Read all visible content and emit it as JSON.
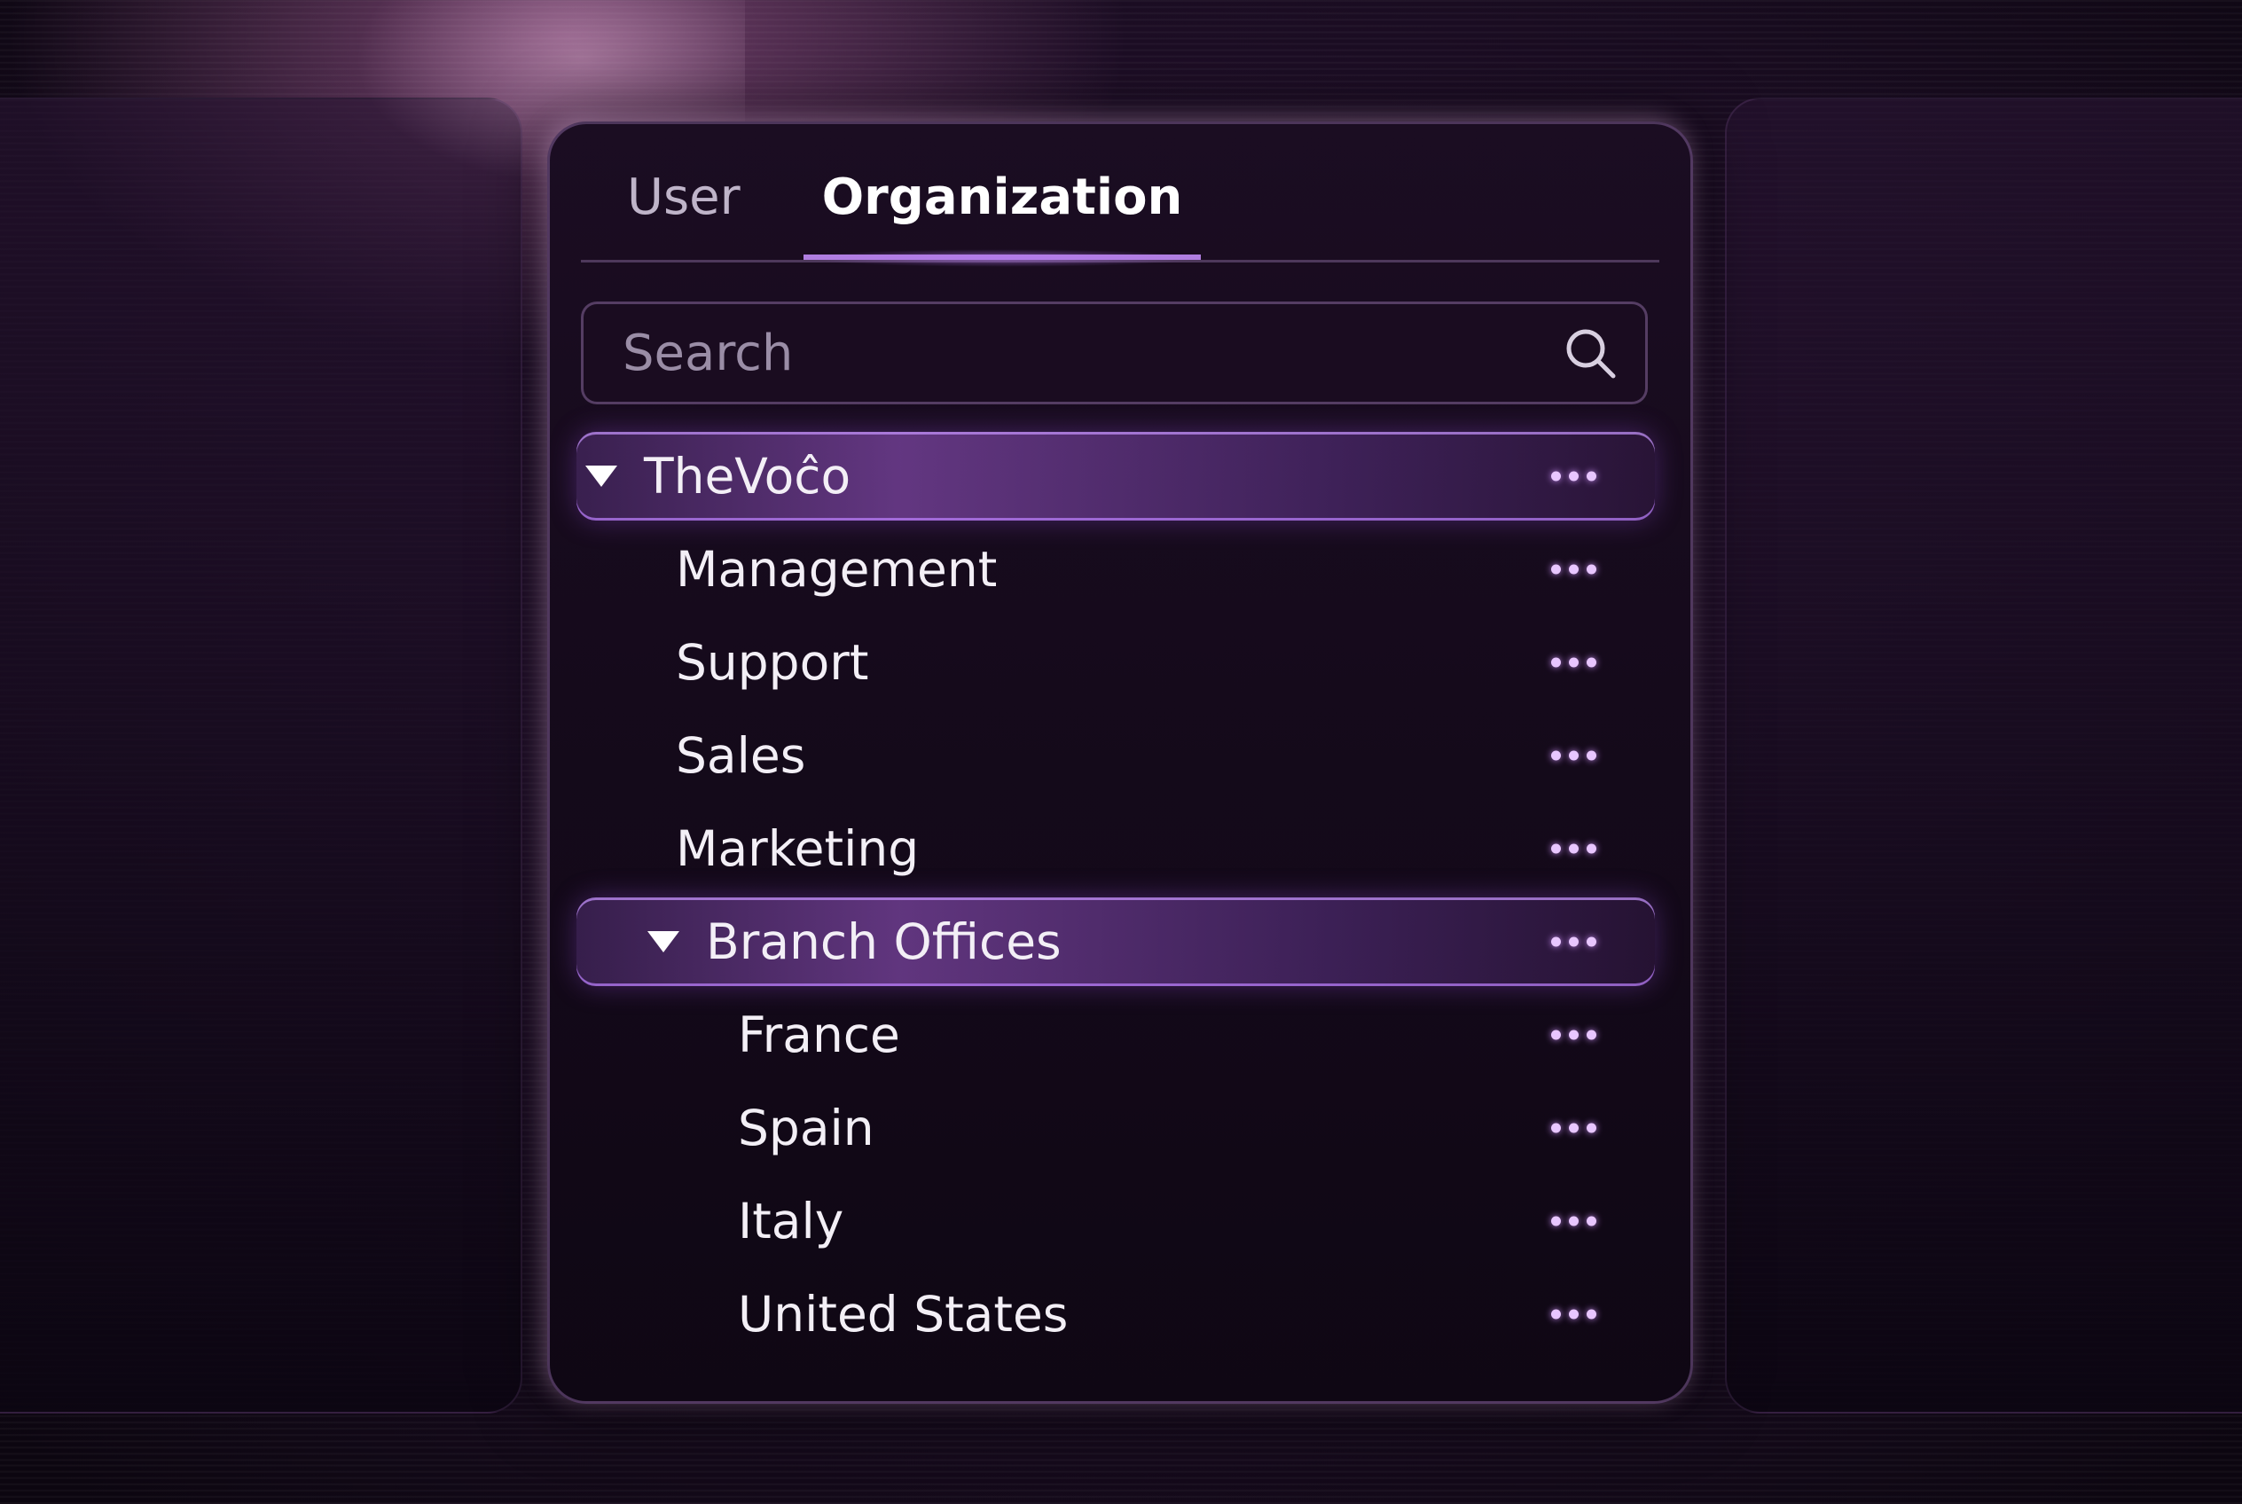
{
  "tabs": {
    "user": "User",
    "organization": "Organization",
    "active": "organization"
  },
  "search": {
    "placeholder": "Search",
    "value": ""
  },
  "tree": {
    "items": [
      {
        "label": "TheVoĉo",
        "level": 0,
        "expanded": true,
        "selected": true
      },
      {
        "label": "Management",
        "level": 1
      },
      {
        "label": "Support",
        "level": 1
      },
      {
        "label": "Sales",
        "level": 1
      },
      {
        "label": "Marketing",
        "level": 1
      },
      {
        "label": "Branch Offices",
        "level": 1,
        "expanded": true,
        "selected": true
      },
      {
        "label": "France",
        "level": 2
      },
      {
        "label": "Spain",
        "level": 2
      },
      {
        "label": "Italy",
        "level": 2
      },
      {
        "label": "United States",
        "level": 2
      }
    ],
    "more_icon": "more-horizontal-icon",
    "expand_icon": "triangle-down-icon"
  },
  "colors": {
    "accent": "#b07ee0",
    "background": "#1c0d24",
    "panel": "#150a1b",
    "text": "#f3eff6",
    "muted_text": "#9a8da6"
  }
}
